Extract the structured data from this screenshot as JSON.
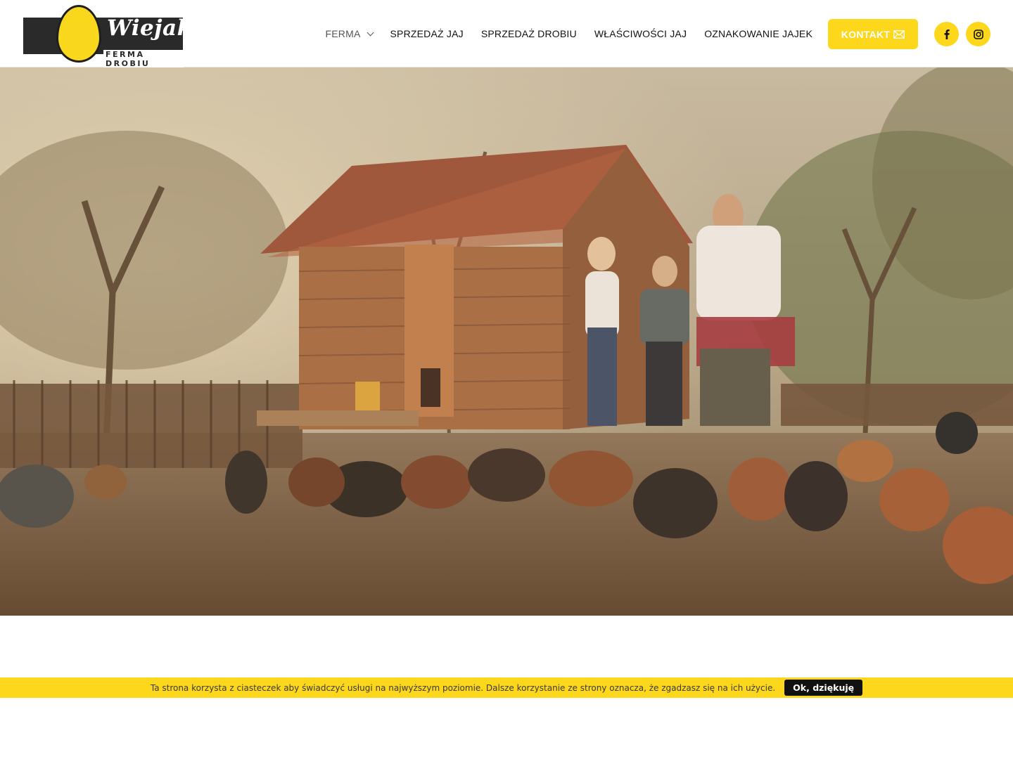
{
  "brand": {
    "name": "Wiejak",
    "tagline": "FERMA DROBIU",
    "accent_color": "#fdd71b",
    "dark_color": "#2a2a2a"
  },
  "nav": {
    "items": [
      {
        "label": "FERMA",
        "active": true,
        "has_dropdown": true
      },
      {
        "label": "SPRZEDAŻ JAJ"
      },
      {
        "label": "SPRZEDAŻ DROBIU"
      },
      {
        "label": "WŁAŚCIWOŚCI JAJ"
      },
      {
        "label": "OZNAKOWANIE JAJEK"
      }
    ],
    "contact_label": "KONTAKT",
    "contact_icon": "envelope-icon",
    "social": [
      {
        "icon": "facebook-icon"
      },
      {
        "icon": "instagram-icon"
      }
    ]
  },
  "hero": {
    "image": "family-feeding-chickens-photo"
  },
  "cookie": {
    "text": "Ta strona korzysta z ciasteczek aby świadczyć usługi na najwyższym poziomie. Dalsze korzystanie ze strony oznacza, że zgadzasz się na ich użycie.",
    "button_label": "Ok, dziękuję"
  }
}
